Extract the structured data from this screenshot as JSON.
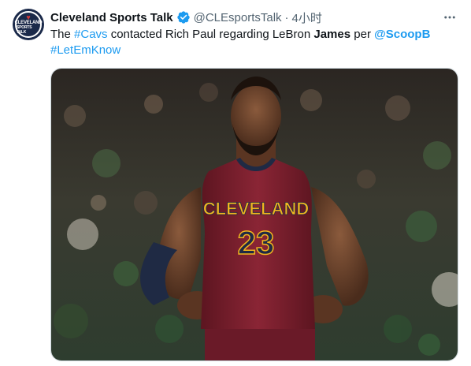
{
  "author": {
    "avatar_text_line1": "CLEVELAND",
    "avatar_text_line2": "SPORTS TALK",
    "display_name": "Cleveland Sports Talk",
    "handle": "@CLEsportsTalk",
    "separator": "·",
    "time": "4小时"
  },
  "tweet": {
    "text_parts": {
      "p1": "The ",
      "hashtag_cavs": "#Cavs",
      "p2": " contacted Rich Paul regarding LeBron ",
      "james": "James",
      "p3": " per ",
      "mention": "@ScoopB",
      "hashtag_letemknow": "#LetEmKnow"
    }
  },
  "media": {
    "jersey_text": "CLEVELAND",
    "jersey_number": "23"
  },
  "colors": {
    "accent": "#1d9bf0",
    "verified": "#1d9bf0",
    "jersey_wine": "#7a1f2b",
    "jersey_gold": "#f2b51e",
    "jersey_navy": "#1f2a44"
  },
  "icons": {
    "verified": "verified-badge-icon",
    "more": "more-horizontal-icon"
  }
}
